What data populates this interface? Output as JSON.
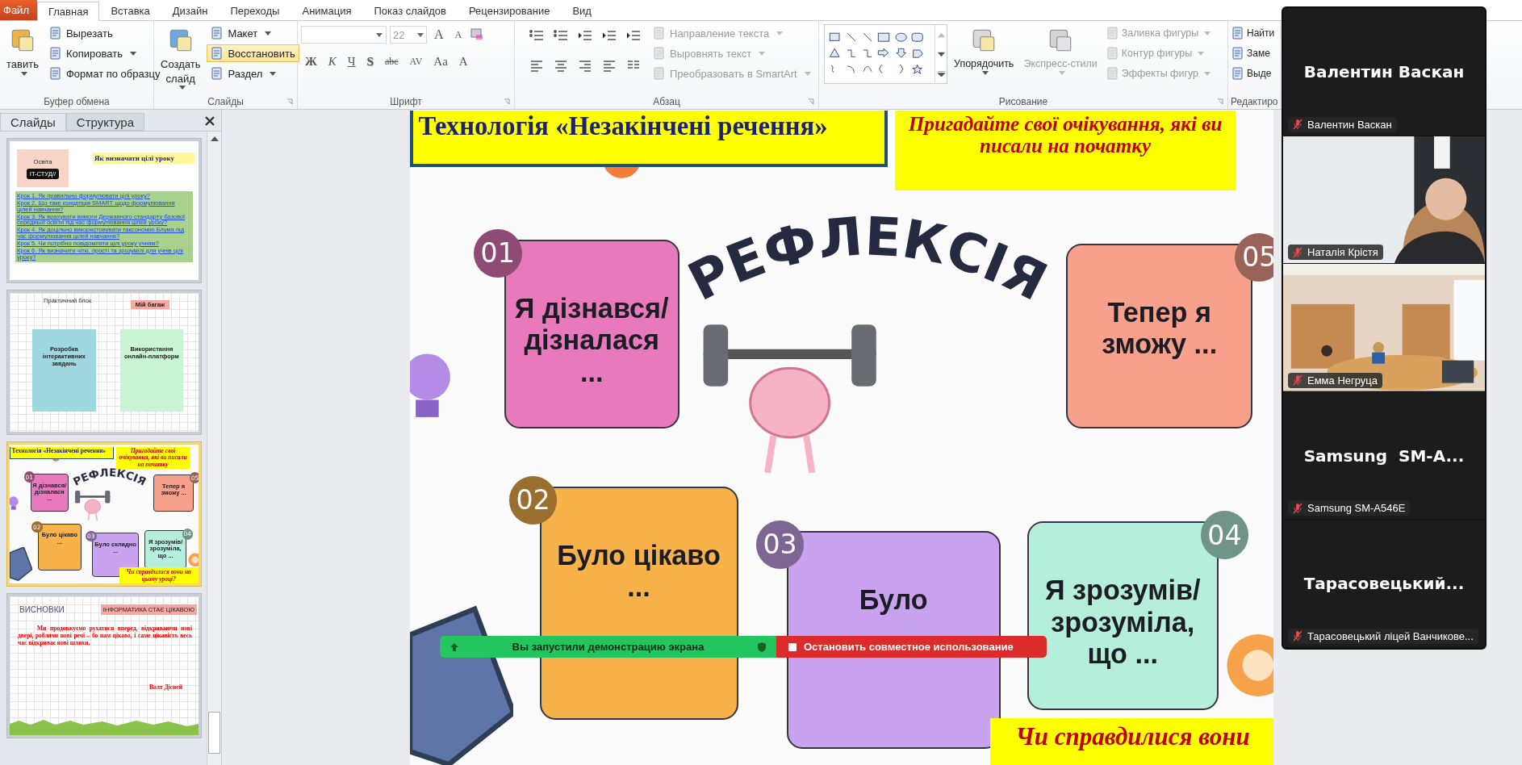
{
  "file_tab": "Файл",
  "tabs": [
    {
      "label": "Главная",
      "selected": true
    },
    {
      "label": "Вставка",
      "selected": false
    },
    {
      "label": "Дизайн",
      "selected": false
    },
    {
      "label": "Переходы",
      "selected": false
    },
    {
      "label": "Анимация",
      "selected": false
    },
    {
      "label": "Показ слайдов",
      "selected": false
    },
    {
      "label": "Рецензирование",
      "selected": false
    },
    {
      "label": "Вид",
      "selected": false
    }
  ],
  "ribbon": {
    "groups": [
      {
        "label": "Буфер обмена",
        "kind": "buttons",
        "items": [
          {
            "kind": "large",
            "label": "тавить",
            "caret": true,
            "disabled": false,
            "highlighted": false
          },
          {
            "kind": "small",
            "label": "Вырезать",
            "caret": false,
            "disabled": false,
            "highlighted": false
          },
          {
            "kind": "small",
            "label": "Копировать",
            "caret": true,
            "disabled": false,
            "highlighted": false
          },
          {
            "kind": "small",
            "label": "Формат по образцу",
            "caret": false,
            "disabled": false,
            "highlighted": false
          }
        ]
      },
      {
        "label": "Слайды",
        "kind": "buttons",
        "items": [
          {
            "kind": "large",
            "label": "Создать слайд",
            "caret": true,
            "disabled": false,
            "highlighted": false
          },
          {
            "kind": "small",
            "label": "Макет",
            "caret": true,
            "disabled": false,
            "highlighted": false
          },
          {
            "kind": "small",
            "label": "Восстановить",
            "caret": false,
            "disabled": false,
            "highlighted": true
          },
          {
            "kind": "small",
            "label": "Раздел",
            "caret": true,
            "disabled": false,
            "highlighted": false
          }
        ]
      },
      {
        "label": "Шрифт",
        "kind": "font",
        "size": "22",
        "size_buttons": [
          "A",
          "A"
        ],
        "format_buttons": [
          "Ж",
          "К",
          "Ч",
          "S",
          "abc",
          "AV",
          "Aa",
          "A"
        ]
      },
      {
        "label": "Абзац",
        "kind": "paragraph",
        "items": [
          {
            "kind": "small",
            "label": "Направление текста",
            "caret": true,
            "disabled": true,
            "highlighted": false
          },
          {
            "kind": "small",
            "label": "Выровнять текст",
            "caret": true,
            "disabled": true,
            "highlighted": false
          },
          {
            "kind": "small",
            "label": "Преобразовать в SmartArt",
            "caret": true,
            "disabled": true,
            "highlighted": false
          }
        ]
      },
      {
        "label": "Рисование",
        "kind": "drawing",
        "items": [
          {
            "kind": "large",
            "label": "Упорядочить",
            "caret": true,
            "disabled": false,
            "highlighted": false
          },
          {
            "kind": "large",
            "label": "Экспресс-стили",
            "caret": true,
            "disabled": true,
            "highlighted": false
          },
          {
            "kind": "small",
            "label": "Заливка фигуры",
            "caret": true,
            "disabled": true,
            "highlighted": false
          },
          {
            "kind": "small",
            "label": "Контур фигуры",
            "caret": true,
            "disabled": true,
            "highlighted": false
          },
          {
            "kind": "small",
            "label": "Эффекты фигур",
            "caret": true,
            "disabled": true,
            "highlighted": false
          }
        ]
      },
      {
        "label": "Редактиро",
        "kind": "buttons",
        "items": [
          {
            "kind": "small",
            "label": "Найти",
            "caret": false,
            "disabled": false,
            "highlighted": false
          },
          {
            "kind": "small",
            "label": "Заме",
            "caret": false,
            "disabled": false,
            "highlighted": false
          },
          {
            "kind": "small",
            "label": "Выде",
            "caret": false,
            "disabled": false,
            "highlighted": false
          }
        ]
      }
    ]
  },
  "slides_panel": {
    "tabs": [
      {
        "label": "Слайды",
        "selected": true
      },
      {
        "label": "Структура",
        "selected": false
      }
    ],
    "thumbnails": [
      {
        "kind": "goals",
        "selected": false,
        "brand": "Освіта",
        "logo": "IT-СТУД//",
        "title": "Як визначати цілі уроку",
        "links": [
          "Крок 1. Як правильно формулювати цілі уроку?",
          "Крок 2. Що таке концепція SMART щодо формулювання цілей навчання?",
          "Крок 3. Як врахувати вимоги Державного стандарту базової середньої освіти під час формулювання цілей уроку?",
          "Крок 4. Як доцільно використовувати таксономію Блума під час формулювання цілей навчання?",
          "Крок 5. Чи потрібно повідомляти цілі уроку учням?",
          "Крок 6. Як визначити чіткі, прості та зрозумілі для учнів цілі уроку?"
        ]
      },
      {
        "kind": "practice",
        "selected": false,
        "title": "Практичний блок",
        "tag": "Мій багаж",
        "notes": [
          "Розробка інтерактивних завдань",
          "Використання онлайн-платформ"
        ]
      },
      {
        "kind": "reflection",
        "selected": true,
        "slide": {
          "title": "Технологія «Незакінчені речення»",
          "prompt": "Пригадайте свої очікування, які ви писали на початку",
          "heading": "РЕФЛЕКСІЯ",
          "cards": [
            {
              "number": "01",
              "text": "Я дізнався/ дізналася ...",
              "color": "#e879bd"
            },
            {
              "number": "05",
              "text": "Тепер я зможу ...",
              "color": "#f7a18c"
            },
            {
              "number": "02",
              "text": "Було цікаво ...",
              "color": "#f8b24a"
            },
            {
              "number": "03",
              "text": "Було складно ...",
              "color": "#c9a3ef"
            },
            {
              "number": "04",
              "text": "Я зрозумів/ зрозуміла, що ...",
              "color": "#b5efdc"
            }
          ],
          "question": "Чи справдилися вони на цьому уроці?"
        }
      },
      {
        "kind": "conclusion",
        "selected": false,
        "title": "ВИСНОВКИ",
        "tag": "ІНФОРМАТИКА СТАЄ ЦІКАВОЮ",
        "quote": "Ми продовжуємо рухатися вперед, відкриваючи нові двері, роблячи нові речі – бо нам цікаво, і саме цікавість весь час відкриває нові шляхи.",
        "author": "Волт Дісней"
      }
    ]
  },
  "slide": {
    "title": "Технологія «Незакінчені речення»",
    "prompt": "Пригадайте свої очікування, які ви писали на початку",
    "heading": "РЕФЛЕКСІЯ",
    "cards": [
      {
        "number": "01",
        "text": "Я дізнався/ дізналася ...",
        "color": "#e879bd"
      },
      {
        "number": "05",
        "text": "Тепер я зможу ...",
        "color": "#f7a18c"
      },
      {
        "number": "02",
        "text": "Було цікаво ...",
        "color": "#f8b24a"
      },
      {
        "number": "03",
        "text": "Було",
        "color": "#c9a3ef"
      },
      {
        "number": "04",
        "text": "Я зрозумів/ зрозуміла, що ...",
        "color": "#b5efdc"
      }
    ],
    "question": "Чи справдилися вони"
  },
  "share_bar": {
    "status": "Вы запустили демонстрацию экрана",
    "stop": "Остановить совместное использование"
  },
  "participants": [
    {
      "kind": "name",
      "display_name": "Валентин Васкан",
      "label": "Валентин Васкан",
      "muted": true
    },
    {
      "kind": "video",
      "label": "Наталія Крістя",
      "muted": true
    },
    {
      "kind": "video",
      "label": "Емма Негруца",
      "muted": true
    },
    {
      "kind": "name",
      "display_name": "Samsung  SM-A...",
      "label": "Samsung SM-A546E",
      "muted": true
    },
    {
      "kind": "name",
      "display_name": "Тарасовецький...",
      "label": "Тарасовецький ліцей Ванчикове...",
      "muted": true
    }
  ]
}
